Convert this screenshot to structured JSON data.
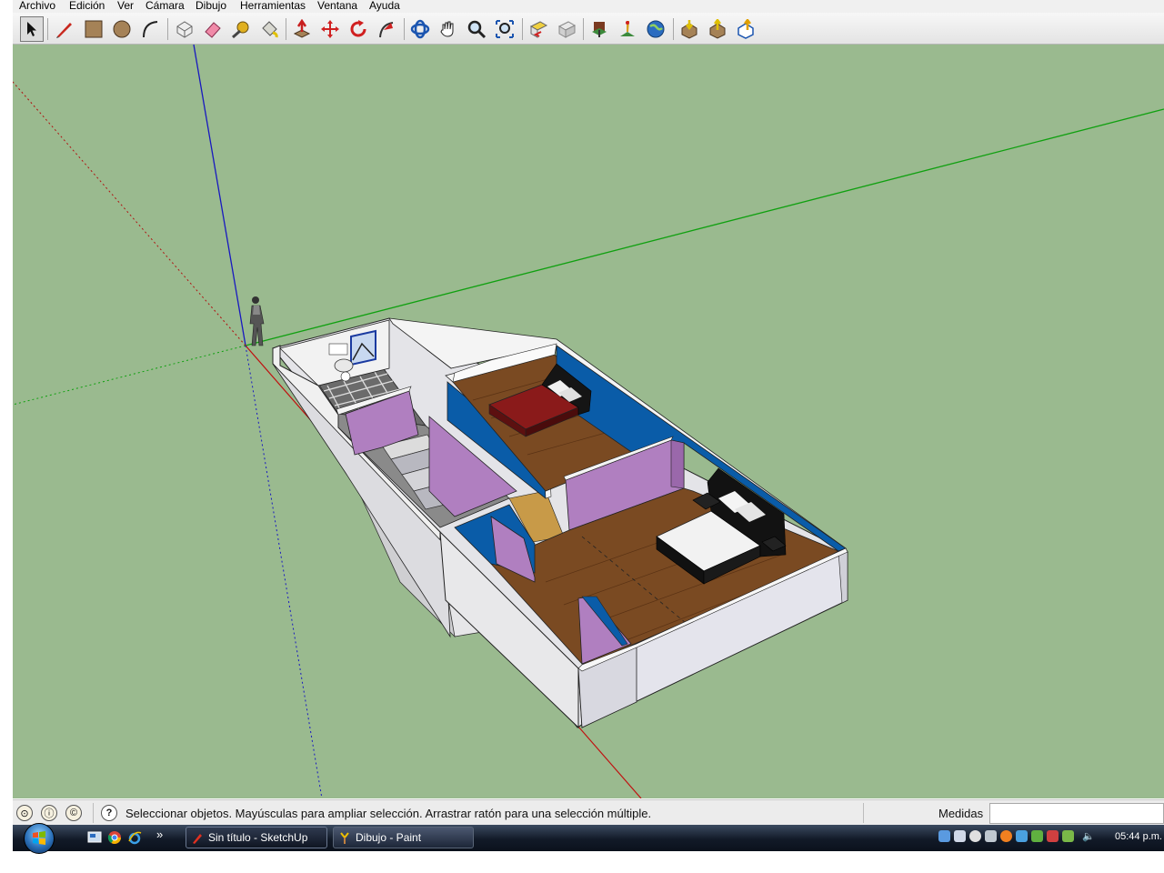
{
  "menu": {
    "items": [
      "Archivo",
      "Edición",
      "Ver",
      "Cámara",
      "Dibujo",
      "Herramientas",
      "Ventana",
      "Ayuda"
    ]
  },
  "toolbar": {
    "tools": [
      {
        "name": "select-tool",
        "icon": "arrow-cursor-icon"
      },
      {
        "name": "pencil-tool",
        "icon": "pencil-icon"
      },
      {
        "name": "rectangle-tool",
        "icon": "rectangle-icon"
      },
      {
        "name": "circle-tool",
        "icon": "circle-icon"
      },
      {
        "name": "arc-tool",
        "icon": "arc-icon"
      },
      {
        "name": "make-component-tool",
        "icon": "component-icon"
      },
      {
        "name": "eraser-tool",
        "icon": "eraser-icon"
      },
      {
        "name": "tape-measure-tool",
        "icon": "tape-measure-icon"
      },
      {
        "name": "paint-bucket-tool",
        "icon": "paint-bucket-icon"
      },
      {
        "name": "push-pull-tool",
        "icon": "push-pull-icon"
      },
      {
        "name": "move-tool",
        "icon": "move-icon"
      },
      {
        "name": "rotate-tool",
        "icon": "rotate-icon"
      },
      {
        "name": "follow-me-tool",
        "icon": "follow-me-icon"
      },
      {
        "name": "orbit-tool",
        "icon": "orbit-icon"
      },
      {
        "name": "pan-tool",
        "icon": "hand-icon"
      },
      {
        "name": "zoom-tool",
        "icon": "magnifier-icon"
      },
      {
        "name": "zoom-extents-tool",
        "icon": "zoom-extents-icon"
      },
      {
        "name": "previous-view-tool",
        "icon": "previous-view-icon"
      },
      {
        "name": "next-view-tool",
        "icon": "next-view-icon"
      },
      {
        "name": "add-location-tool",
        "icon": "location-icon"
      },
      {
        "name": "toggle-terrain-tool",
        "icon": "terrain-icon"
      },
      {
        "name": "google-earth-tool",
        "icon": "globe-icon"
      },
      {
        "name": "get-models-tool",
        "icon": "get-models-icon"
      },
      {
        "name": "share-model-tool",
        "icon": "share-model-icon"
      },
      {
        "name": "share-component-tool",
        "icon": "share-component-icon"
      }
    ]
  },
  "status": {
    "message": "Seleccionar objetos. Mayúsculas para ampliar selección. Arrastrar ratón para una selección múltiple.",
    "measurements_label": "Medidas",
    "measurements_value": "",
    "icons": [
      "geo-location-icon",
      "credits-icon",
      "copyright-icon",
      "help-icon"
    ]
  },
  "taskbar": {
    "tasks": [
      {
        "label": "Sin título - SketchUp",
        "active": true
      },
      {
        "label": "Dibujo - Paint",
        "active": false
      }
    ],
    "overflow": "»",
    "clock": "05:44 p.m."
  },
  "colors": {
    "viewport_bg": "#9aba8f",
    "wall_blue": "#0a5ca8",
    "wall_lilac": "#b07fc0",
    "floor_wood": "#7a4a22",
    "wall_white": "#e4e4e8"
  }
}
